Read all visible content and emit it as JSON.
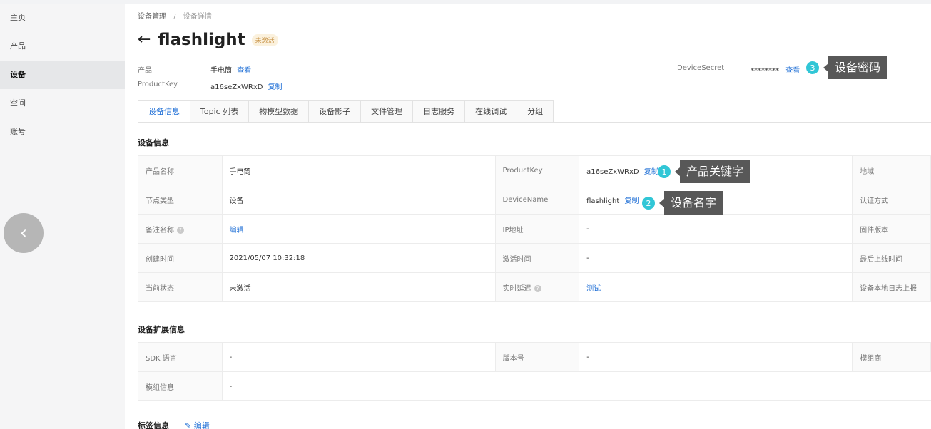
{
  "sidebar": {
    "items": [
      {
        "label": "主页"
      },
      {
        "label": "产品"
      },
      {
        "label": "设备"
      },
      {
        "label": "空间"
      },
      {
        "label": "账号"
      }
    ]
  },
  "breadcrumb": {
    "parent": "设备管理",
    "separator": "/",
    "current": "设备详情"
  },
  "header": {
    "title": "flashlight",
    "status_badge": "未激活"
  },
  "meta": {
    "product_label": "产品",
    "product_value": "手电筒",
    "product_link": "查看",
    "productkey_label": "ProductKey",
    "productkey_value": "a16seZxWRxD",
    "productkey_link": "复制",
    "secret_label": "DeviceSecret",
    "secret_value": "********",
    "secret_link": "查看"
  },
  "tabs": [
    {
      "label": "设备信息"
    },
    {
      "label": "Topic 列表"
    },
    {
      "label": "物模型数据"
    },
    {
      "label": "设备影子"
    },
    {
      "label": "文件管理"
    },
    {
      "label": "日志服务"
    },
    {
      "label": "在线调试"
    },
    {
      "label": "分组"
    }
  ],
  "device_info": {
    "title": "设备信息",
    "rows": [
      {
        "l1": "产品名称",
        "v1": "手电筒",
        "l2": "ProductKey",
        "v2": "a16seZxWRxD",
        "v2_link": "复制",
        "l3": "地域"
      },
      {
        "l1": "节点类型",
        "v1": "设备",
        "l2": "DeviceName",
        "v2": "flashlight",
        "v2_link": "复制",
        "l3": "认证方式"
      },
      {
        "l1": "备注名称",
        "v1": "编辑",
        "l2": "IP地址",
        "v2": "-",
        "l3": "固件版本"
      },
      {
        "l1": "创建时间",
        "v1": "2021/05/07 10:32:18",
        "l2": "激活时间",
        "v2": "-",
        "l3": "最后上线时间"
      },
      {
        "l1": "当前状态",
        "v1": "未激活",
        "l2": "实时延迟",
        "v2": "测试",
        "l3": "设备本地日志上报"
      }
    ]
  },
  "ext_info": {
    "title": "设备扩展信息",
    "rows": [
      {
        "l1": "SDK 语言",
        "v1": "-",
        "l2": "版本号",
        "v2": "-",
        "l3": "模组商"
      },
      {
        "l1": "模组信息",
        "v1": "-"
      }
    ]
  },
  "tags": {
    "title": "标签信息",
    "edit": "编辑"
  },
  "callouts": [
    {
      "num": "1",
      "text": "产品关键字"
    },
    {
      "num": "2",
      "text": "设备名字"
    },
    {
      "num": "3",
      "text": "设备密码"
    }
  ],
  "colors": {
    "link": "#1f6fd6",
    "callout_badge": "#31c6d6",
    "callout_tip": "#585858",
    "status_badge_bg": "#fbf1dd"
  }
}
